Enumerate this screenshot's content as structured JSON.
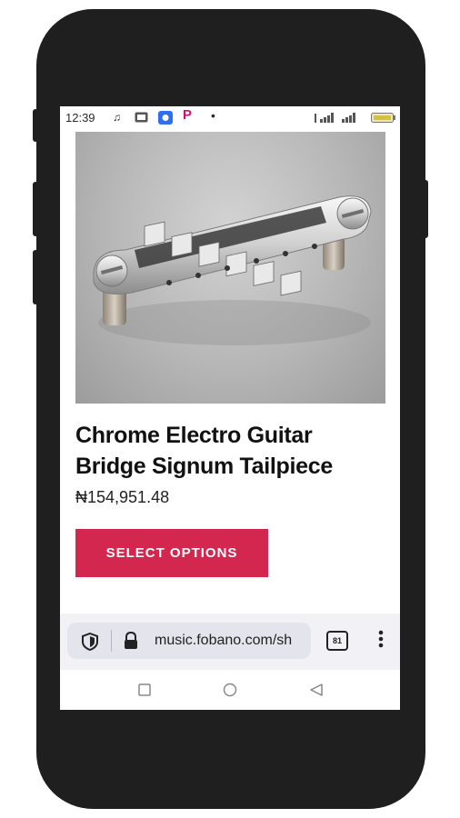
{
  "status_bar": {
    "time": "12:39",
    "icons": [
      "music-note-icon",
      "gallery-icon",
      "app-icon",
      "p-icon",
      "dot-icon",
      "signal-icon",
      "battery-icon"
    ]
  },
  "product": {
    "image_alt": "chrome-guitar-bridge-image",
    "title_line1": "Chrome Electro Guitar",
    "title_line2": "Bridge Signum Tailpiece",
    "price": "₦154,951.48",
    "button_label": "SELECT OPTIONS"
  },
  "browser": {
    "url": "music.fobano.com/sh",
    "tab_count": "81"
  },
  "colors": {
    "accent": "#d4274f",
    "browser_bar": "#f1f1f6",
    "phone_body": "#1f1f1f"
  }
}
